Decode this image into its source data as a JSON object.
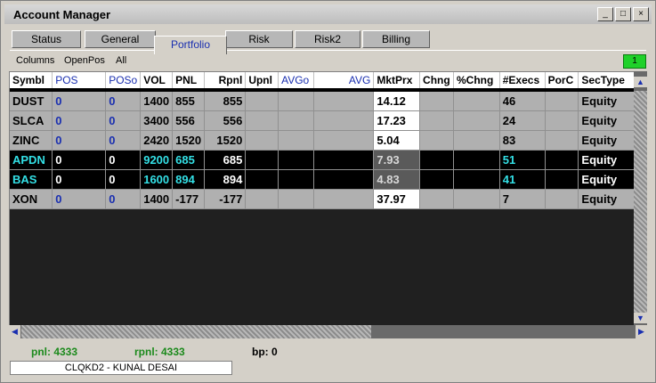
{
  "window": {
    "title": "Account Manager",
    "buttons": [
      "_",
      "□",
      "×"
    ]
  },
  "tabs": [
    {
      "label": "Status",
      "active": false
    },
    {
      "label": "General",
      "active": false
    },
    {
      "label": "Portfolio",
      "active": true
    },
    {
      "label": "Risk",
      "active": false
    },
    {
      "label": "Risk2",
      "active": false
    },
    {
      "label": "Billing",
      "active": false
    }
  ],
  "toolbar": {
    "columns": "Columns",
    "openpos": "OpenPos",
    "all": "All",
    "badge": "1"
  },
  "columns": [
    "Symbl",
    "POS",
    "POSo",
    "VOL",
    "PNL",
    "Rpnl",
    "Upnl",
    "AVGo",
    "AVG",
    "MktPrx",
    "Chng",
    "%Chng",
    "#Execs",
    "PorC",
    "SecType"
  ],
  "rows": [
    {
      "style": "gray",
      "cells": [
        "DUST",
        "0",
        "0",
        "1400",
        "855",
        "855",
        "",
        "",
        "",
        "14.12",
        "",
        "",
        "46",
        "",
        "Equity"
      ]
    },
    {
      "style": "gray",
      "cells": [
        "SLCA",
        "0",
        "0",
        "3400",
        "556",
        "556",
        "",
        "",
        "",
        "17.23",
        "",
        "",
        "24",
        "",
        "Equity"
      ]
    },
    {
      "style": "gray",
      "cells": [
        "ZINC",
        "0",
        "0",
        "2420",
        "1520",
        "1520",
        "",
        "",
        "",
        "5.04",
        "",
        "",
        "83",
        "",
        "Equity"
      ]
    },
    {
      "style": "black",
      "cells": [
        "APDN",
        "0",
        "0",
        "9200",
        "685",
        "685",
        "",
        "",
        "",
        "7.93",
        "",
        "",
        "51",
        "",
        "Equity"
      ]
    },
    {
      "style": "black",
      "cells": [
        "BAS",
        "0",
        "0",
        "1600",
        "894",
        "894",
        "",
        "",
        "",
        "4.83",
        "",
        "",
        "41",
        "",
        "Equity"
      ]
    },
    {
      "style": "gray",
      "cells": [
        "XON",
        "0",
        "0",
        "1400",
        "-177",
        "-177",
        "",
        "",
        "",
        "37.97",
        "",
        "",
        "7",
        "",
        "Equity"
      ]
    }
  ],
  "status": {
    "pnl": "pnl: 4333",
    "rpnl": "rpnl: 4333",
    "bp": "bp: 0",
    "account": "CLQKD2 - KUNAL DESAI"
  },
  "colors": {
    "accent_blue": "#1a2fb0",
    "cyan": "#33e0e6",
    "status_green": "#1c8a1c",
    "badge_green": "#1fd12a"
  }
}
